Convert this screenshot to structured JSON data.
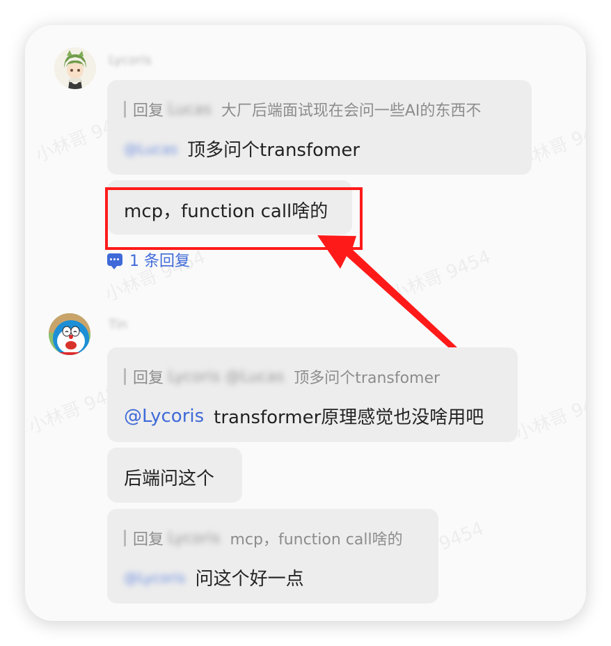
{
  "watermark": "小林哥 9454",
  "users": {
    "first": {
      "name": "Lycoris"
    },
    "second": {
      "name": "Tin"
    }
  },
  "messages": {
    "m1": {
      "quote_prefix": "回复",
      "quote_user": "Lucas",
      "quote_text": "大厂后端面试现在会问一些AI的东西不",
      "mention": "@Lucas",
      "text": "顶多问个transfomer"
    },
    "m2": {
      "text": "mcp，function call啥的"
    },
    "m2_replies": "1 条回复",
    "m3": {
      "quote_prefix": "回复",
      "quote_user": "Lycoris @Lucas",
      "quote_text": "顶多问个transfomer",
      "mention": "@Lycoris",
      "text": "transformer原理感觉也没啥用吧"
    },
    "m4": {
      "text": "后端问这个"
    },
    "m5": {
      "quote_prefix": "回复",
      "quote_user": "Lycoris",
      "quote_text": "mcp，function call啥的",
      "mention": "@Lycoris",
      "text": "问这个好一点"
    }
  },
  "colors": {
    "highlight": "#ff1a1a",
    "link": "#3f6ad8",
    "bubble": "#ededed"
  }
}
